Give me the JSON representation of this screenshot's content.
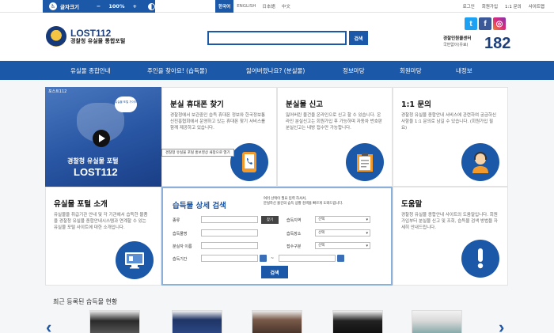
{
  "topbar": {
    "font_size_label": "글자크기",
    "minus": "−",
    "zoom": "100%",
    "plus": "+",
    "languages": [
      "한국어",
      "ENGLISH",
      "日本語",
      "中文"
    ],
    "links": [
      "로그인",
      "회원가입",
      "1:1 문의",
      "사이트맵"
    ]
  },
  "header": {
    "logo_en": "LOST112",
    "logo_ko": "경찰청 유실물 통합포털",
    "search_button": "검색",
    "callcenter_name": "경찰민원콜센터",
    "callcenter_sub": "국번없이(유료)",
    "callcenter_number": "182"
  },
  "social": {
    "twitter": "t",
    "facebook": "f",
    "instagram": "◎"
  },
  "nav": [
    "유실물 종합안내",
    "주인을 찾아요! (습득물)",
    "잃어버렸나요? (분실물)",
    "정보마당",
    "회원마당",
    "내정보"
  ],
  "video": {
    "tag": "포스트112",
    "bubble": "유실물 포털 가이드",
    "title1": "경찰청 유실물 포털",
    "title2": "LOST112",
    "tooltip": "경찰청 유실물 포털 홍보영상 새창으로 열기"
  },
  "cards": {
    "phone": {
      "title": "분실 휴대폰 찾기",
      "desc": "경찰청에서 보관중인 습득 휴대폰 정보와 한국정보통신진흥협회에서 운영하고 있는 휴대폰 찾기 서비스를 함께 제공하고 있습니다."
    },
    "report": {
      "title": "분실물 신고",
      "desc": "잃어버린 물건을 온라인으로 신고 할 수 있습니다. 온라인 분실신고는 회원가입 후 가능하며 자동차 번호판 분실신고는 내방 접수만 가능합니다."
    },
    "qna": {
      "title": "1:1 문의",
      "desc": "경찰청 유실물 종합안내 서비스에 관련하여 궁금하신 사항을 1:1 문의로 남길 수 있습니다. (회원가입 필요)"
    },
    "intro": {
      "title": "유실물 포털 소개",
      "desc": "유실물을 취급기관 안내 및 각 기관에서 습득한 물품을 경찰청 유실물 종합안내시스템과 연계할 수 있는 유실물 포털 사이트에 대한 소개입니다."
    },
    "help": {
      "title": "도움말",
      "desc": "경찰청 유실물 종합안내 사이트의 도움말입니다. 회원가입부터 분실물 신고 및 조회, 습득물 검색 방법을 자세히 안내드립니다."
    }
  },
  "search": {
    "title": "습득물 상세 검색",
    "hint1": "여러 선택이 필요 입력 하셔서,",
    "hint2": "분실하신 물건의 습득 상황 검색을 빠르게 도와드립니다.",
    "kind_label": "종류",
    "find_button": "찾기",
    "item_name_label": "습득물명",
    "lost_person_label": "분실자 이름",
    "period_label": "습득기간",
    "tilde": "~",
    "area_label": "습득지역",
    "place_label": "습득장소",
    "reg_label": "접수구분",
    "select": "선택",
    "submit": "검색"
  },
  "recent": {
    "title": "최근 등록된 습득물 현황",
    "prev": "‹",
    "next": "›"
  },
  "colors": {
    "primary": "#1c58a8",
    "nav": "#1c58a8",
    "accent_dark": "#1c3f7d"
  }
}
